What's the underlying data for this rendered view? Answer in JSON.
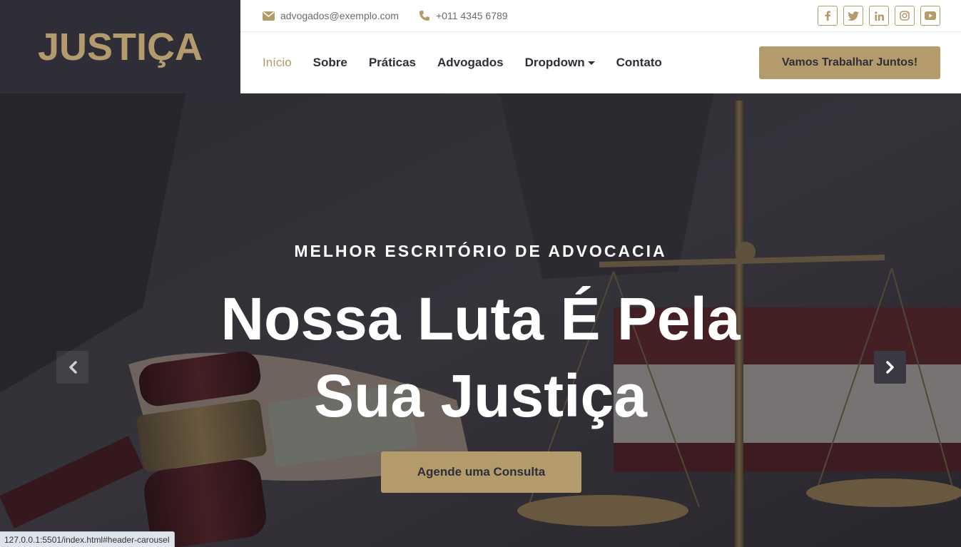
{
  "brand": {
    "logo_text": "JUSTIÇA"
  },
  "topbar": {
    "email": "advogados@exemplo.com",
    "phone": "+011 4345 6789",
    "socials": [
      "facebook-icon",
      "twitter-icon",
      "linkedin-icon",
      "instagram-icon",
      "youtube-icon"
    ]
  },
  "nav": {
    "items": [
      {
        "label": "Início",
        "active": true
      },
      {
        "label": "Sobre"
      },
      {
        "label": "Práticas"
      },
      {
        "label": "Advogados"
      },
      {
        "label": "Dropdown",
        "dropdown": true
      },
      {
        "label": "Contato"
      }
    ],
    "cta_label": "Vamos Trabalhar Juntos!"
  },
  "hero": {
    "eyebrow": "MELHOR ESCRITÓRIO DE ADVOCACIA",
    "headline": "Nossa Luta É Pela Sua Justiça",
    "button_label": "Agende uma Consulta"
  },
  "status_url": "127.0.0.1:5501/index.html#header-carousel",
  "colors": {
    "accent": "#b39b6c",
    "dark": "#2f2e38"
  }
}
